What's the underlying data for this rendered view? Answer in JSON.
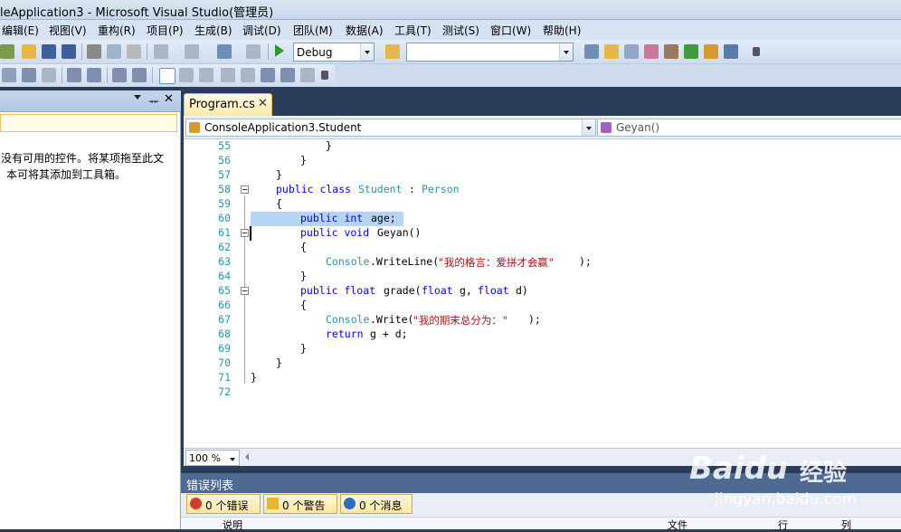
{
  "window": {
    "title": "leApplication3 - Microsoft Visual Studio(管理员)"
  },
  "menu": [
    "编辑(E)",
    "视图(V)",
    "重构(R)",
    "项目(P)",
    "生成(B)",
    "调试(D)",
    "团队(M)",
    "数据(A)",
    "工具(T)",
    "测试(S)",
    "窗口(W)",
    "帮助(H)"
  ],
  "toolbar": {
    "config_value": "Debug",
    "platform_value": ""
  },
  "toolbox": {
    "empty_message_line1": "没有可用的控件。将某项拖至此文",
    "empty_message_line2": "本可将其添加到工具箱。"
  },
  "editor": {
    "tab_label": "Program.cs",
    "tab_close": "✕",
    "nav_class": "ConsoleApplication3.Student",
    "nav_member": "Geyan()",
    "zoom": "100 %",
    "line_numbers": [
      "55",
      "56",
      "57",
      "58",
      "59",
      "60",
      "61",
      "62",
      "63",
      "64",
      "65",
      "66",
      "67",
      "68",
      "69",
      "70",
      "71",
      "72"
    ],
    "code": {
      "l55": "}",
      "l56": "}",
      "l57": "}",
      "l58_kw": "public class",
      "l58_name": "Student",
      "l58_colon": ":",
      "l58_base": "Person",
      "l59": "{",
      "l60_kw": "public int",
      "l60_rest": "age;",
      "l61_kw": "public void",
      "l61_rest": "Geyan()",
      "l62": "{",
      "l63_type": "Console",
      "l63_mid": ".WriteLine(",
      "l63_str": "\"我的格言：爱拼才会赢\"",
      "l63_end": ");",
      "l64": "}",
      "l65_kw1": "public float",
      "l65_mid1": "grade(",
      "l65_kw2": "float",
      "l65_mid2": "g,",
      "l65_kw3": "float",
      "l65_mid3": "d)",
      "l66": "{",
      "l67_type": "Console",
      "l67_mid": ".Write(",
      "l67_str": "\"我的期末总分为：\"",
      "l67_end": ");",
      "l68_kw": "return",
      "l68_rest": "g + d;",
      "l69": "}",
      "l70": "}",
      "l71": "}"
    }
  },
  "error_list": {
    "title": "错误列表",
    "errors_label": "0 个错误",
    "warnings_label": "0 个警告",
    "messages_label": "0 个消息",
    "col_description": "说明",
    "col_file": "文件",
    "col_line": "行",
    "col_column": "列"
  },
  "watermark": {
    "brand": "Baidu",
    "brand_cn": "经验",
    "url": "jingyan.baidu.com"
  }
}
